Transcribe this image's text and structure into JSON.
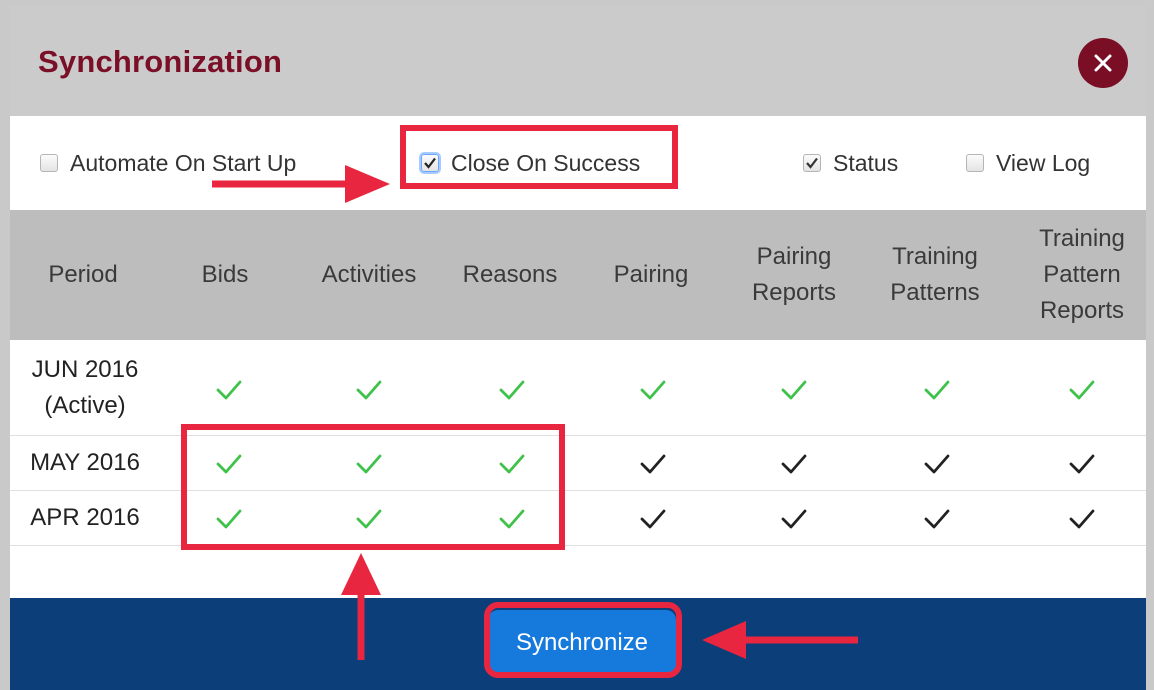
{
  "dialog": {
    "title": "Synchronization",
    "close_icon": "close-icon",
    "accent_color": "#7b0f27"
  },
  "options": [
    {
      "label": "Automate On Start Up",
      "checked": false
    },
    {
      "label": "Close On Success",
      "checked": true
    },
    {
      "label": "Status",
      "checked": true
    },
    {
      "label": "View Log",
      "checked": false
    }
  ],
  "table": {
    "columns": [
      "Period",
      "Bids",
      "Activities",
      "Reasons",
      "Pairing",
      "Pairing Reports",
      "Training Patterns",
      "Training Pattern Reports"
    ],
    "rows": [
      {
        "period": "JUN 2016",
        "period_note": "(Active)",
        "status": [
          "green-check-icon",
          "green-check-icon",
          "green-check-icon",
          "green-check-icon",
          "green-check-icon",
          "green-check-icon",
          "green-check-icon"
        ]
      },
      {
        "period": "MAY 2016",
        "status": [
          "green-check-icon",
          "green-check-icon",
          "green-check-icon",
          "black-check-icon",
          "black-check-icon",
          "black-check-icon",
          "black-check-icon"
        ]
      },
      {
        "period": "APR 2016",
        "status": [
          "green-check-icon",
          "green-check-icon",
          "green-check-icon",
          "black-check-icon",
          "black-check-icon",
          "black-check-icon",
          "black-check-icon"
        ]
      }
    ],
    "colors": {
      "green_check": "#3fc24a",
      "black_check": "#222222"
    }
  },
  "footer": {
    "synchronize_label": "Synchronize",
    "button_color": "#1679dc",
    "background_color": "#0c3e7a"
  },
  "annotations": {
    "highlight_color": "#e8263f"
  }
}
